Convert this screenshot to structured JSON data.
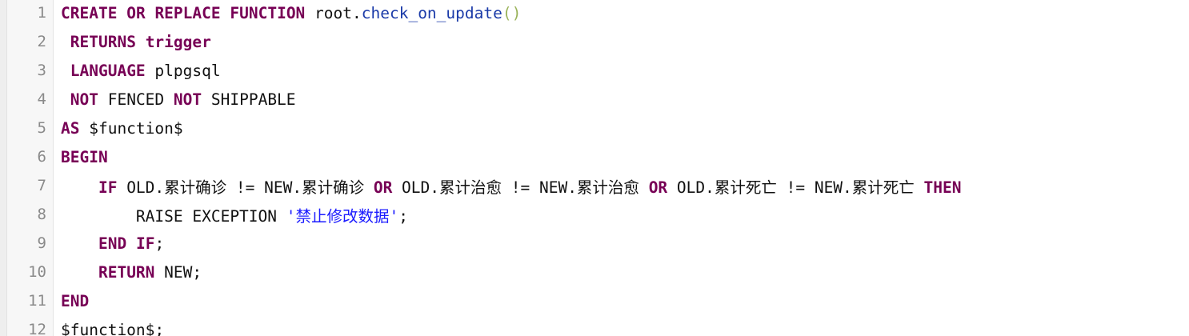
{
  "editor": {
    "lines": [
      {
        "num": "1",
        "tokens": [
          {
            "t": "CREATE",
            "c": "kw"
          },
          {
            "t": " ",
            "c": "plain"
          },
          {
            "t": "OR",
            "c": "kw"
          },
          {
            "t": " ",
            "c": "plain"
          },
          {
            "t": "REPLACE",
            "c": "kw"
          },
          {
            "t": " ",
            "c": "plain"
          },
          {
            "t": "FUNCTION",
            "c": "kw"
          },
          {
            "t": " root.",
            "c": "plain"
          },
          {
            "t": "check_on_update",
            "c": "fn"
          },
          {
            "t": "()",
            "c": "paren"
          }
        ]
      },
      {
        "num": "2",
        "tokens": [
          {
            "t": " ",
            "c": "plain"
          },
          {
            "t": "RETURNS",
            "c": "kw"
          },
          {
            "t": " ",
            "c": "plain"
          },
          {
            "t": "trigger",
            "c": "kw"
          }
        ]
      },
      {
        "num": "3",
        "tokens": [
          {
            "t": " ",
            "c": "plain"
          },
          {
            "t": "LANGUAGE",
            "c": "kw"
          },
          {
            "t": " plpgsql",
            "c": "plain"
          }
        ]
      },
      {
        "num": "4",
        "tokens": [
          {
            "t": " ",
            "c": "plain"
          },
          {
            "t": "NOT",
            "c": "kw"
          },
          {
            "t": " FENCED ",
            "c": "plain"
          },
          {
            "t": "NOT",
            "c": "kw"
          },
          {
            "t": " SHIPPABLE",
            "c": "plain"
          }
        ]
      },
      {
        "num": "5",
        "tokens": [
          {
            "t": "AS",
            "c": "kw"
          },
          {
            "t": " $function$",
            "c": "plain"
          }
        ]
      },
      {
        "num": "6",
        "tokens": [
          {
            "t": "BEGIN",
            "c": "kw"
          }
        ]
      },
      {
        "num": "7",
        "tokens": [
          {
            "t": "    ",
            "c": "plain"
          },
          {
            "t": "IF",
            "c": "kw"
          },
          {
            "t": " OLD.累计确诊 != NEW.累计确诊 ",
            "c": "plain"
          },
          {
            "t": "OR",
            "c": "kw"
          },
          {
            "t": " OLD.累计治愈 != NEW.累计治愈 ",
            "c": "plain"
          },
          {
            "t": "OR",
            "c": "kw"
          },
          {
            "t": " OLD.累计死亡 != NEW.累计死亡 ",
            "c": "plain"
          },
          {
            "t": "THEN",
            "c": "kw"
          }
        ]
      },
      {
        "num": "8",
        "tokens": [
          {
            "t": "        RAISE EXCEPTION ",
            "c": "plain"
          },
          {
            "t": "'禁止修改数据'",
            "c": "str"
          },
          {
            "t": ";",
            "c": "plain"
          }
        ]
      },
      {
        "num": "9",
        "tokens": [
          {
            "t": "    ",
            "c": "plain"
          },
          {
            "t": "END",
            "c": "kw"
          },
          {
            "t": " ",
            "c": "plain"
          },
          {
            "t": "IF",
            "c": "kw"
          },
          {
            "t": ";",
            "c": "plain"
          }
        ]
      },
      {
        "num": "10",
        "tokens": [
          {
            "t": "    ",
            "c": "plain"
          },
          {
            "t": "RETURN",
            "c": "kw"
          },
          {
            "t": " NEW;",
            "c": "plain"
          }
        ]
      },
      {
        "num": "11",
        "tokens": [
          {
            "t": "END",
            "c": "kw"
          }
        ]
      },
      {
        "num": "12",
        "tokens": [
          {
            "t": "$function$;",
            "c": "plain"
          }
        ]
      }
    ]
  },
  "colors": {
    "keyword": "#770055",
    "function_name": "#1a3aa8",
    "string": "#1b1bff",
    "paren": "#9ab35a",
    "line_number": "#8a8a8a",
    "gutter_bg": "#f7f7f7"
  }
}
